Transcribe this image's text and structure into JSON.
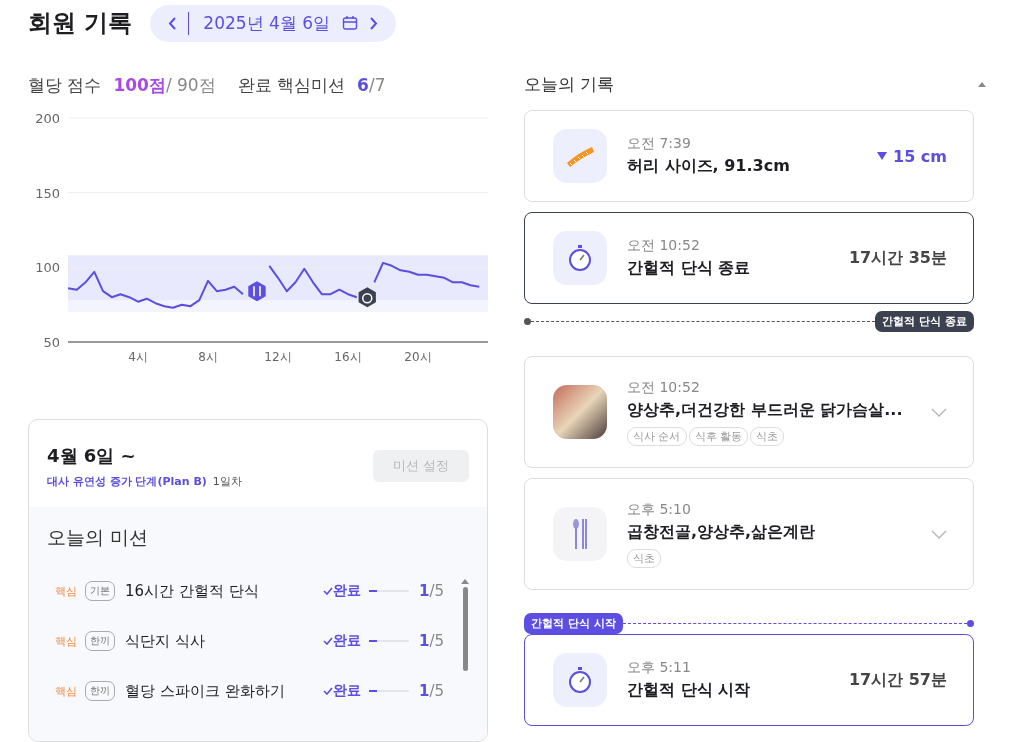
{
  "header": {
    "title": "회원 기록",
    "date": "2025년 4월 6일"
  },
  "scores": [
    {
      "label": "혈당 점수",
      "value": "100점",
      "target": "/ 90점"
    },
    {
      "label": "완료 핵심미션",
      "value": "**6**/7"
    }
  ],
  "chart_data": {
    "type": "line",
    "x": [
      0,
      0.5,
      1,
      1.5,
      2,
      2.5,
      3,
      3.5,
      4,
      4.5,
      5,
      5.5,
      6,
      6.5,
      7,
      7.5,
      8,
      8.5,
      9,
      9.5,
      10,
      10.5,
      11,
      11.5,
      12,
      12.5,
      13,
      13.5,
      14,
      14.5,
      15,
      15.5,
      16,
      16.5,
      17,
      17.5,
      18,
      18.5,
      19,
      19.5,
      20,
      20.5,
      21,
      21.5,
      22,
      22.5,
      23,
      23.5
    ],
    "series": [
      {
        "color": "#5b4ee0",
        "values": [
          86,
          85,
          90,
          97,
          84,
          80,
          82,
          80,
          77,
          79,
          76,
          74,
          73,
          75,
          74,
          78,
          91,
          84,
          85,
          87,
          82,
          null,
          null,
          101,
          93,
          84,
          90,
          99,
          90,
          82,
          82,
          85,
          82,
          80,
          null,
          90,
          103,
          101,
          98,
          97,
          95,
          95,
          94,
          93,
          90,
          90,
          88,
          87
        ]
      }
    ],
    "bands": [
      {
        "axis": "y",
        "from": 70,
        "to": 108,
        "color": "#f3f4fe"
      },
      {
        "axis": "y",
        "from": 78,
        "to": 108,
        "color": "#e8e9fd"
      }
    ],
    "xlim": [
      0,
      24
    ],
    "ylim": [
      50,
      200
    ],
    "yticks": [
      50,
      100,
      150,
      200
    ],
    "xticks": [
      {
        "value": 4,
        "label": "4시"
      },
      {
        "value": 8,
        "label": "8시"
      },
      {
        "value": 12,
        "label": "12시"
      },
      {
        "value": 16,
        "label": "16시"
      },
      {
        "value": 20,
        "label": "20시"
      }
    ]
  },
  "plan": {
    "start": "4월 6일 ~",
    "name": "대사 유연성 증가 단계(Plan B)",
    "day": "1일차",
    "button": {
      "label": "미션 설정",
      "disabled": true
    }
  },
  "missions_title": "오늘의 미션",
  "missions": [
    {
      "priority": "핵심",
      "category": "기본",
      "title": "16시간 간헐적 단식",
      "status": "완료",
      "level": 0.2,
      "progress": "**1**/5"
    },
    {
      "priority": "핵심",
      "category": "한끼",
      "title": "식단지 식사",
      "status": "완료",
      "level": 0.2,
      "progress": "**1**/5"
    },
    {
      "priority": "핵심",
      "category": "한끼",
      "title": "혈당 스파이크 완화하기",
      "status": "완료",
      "level": 0.2,
      "progress": "**1**/5"
    }
  ],
  "records_title": "오늘의 기록",
  "timeline": [
    {
      "kind": "waist",
      "time": "오전 7:39",
      "title": "허리 사이즈, 91.3cm",
      "change": "15 cm"
    },
    {
      "kind": "fast_end",
      "time": "오전 10:52",
      "title": "간헐적 단식 종료",
      "duration": "17시간 35분"
    },
    {
      "kind": "end_marker",
      "label": "간헐적 단식 종료"
    },
    {
      "kind": "meal_photo",
      "time": "오전 10:52",
      "title": "양상추,더건강한 부드러운 닭가슴살...",
      "tags": [
        "식사 순서",
        "식후 활동",
        "식초"
      ]
    },
    {
      "kind": "meal",
      "time": "오후 5:10",
      "title": "곱창전골,양상추,삶은계란",
      "tags": [
        "식초"
      ]
    },
    {
      "kind": "start_marker",
      "label": "간헐적 단식 시작"
    },
    {
      "kind": "fast_start",
      "time": "오후 5:11",
      "title": "간헐적 단식 시작",
      "duration": "17시간 57분"
    }
  ]
}
